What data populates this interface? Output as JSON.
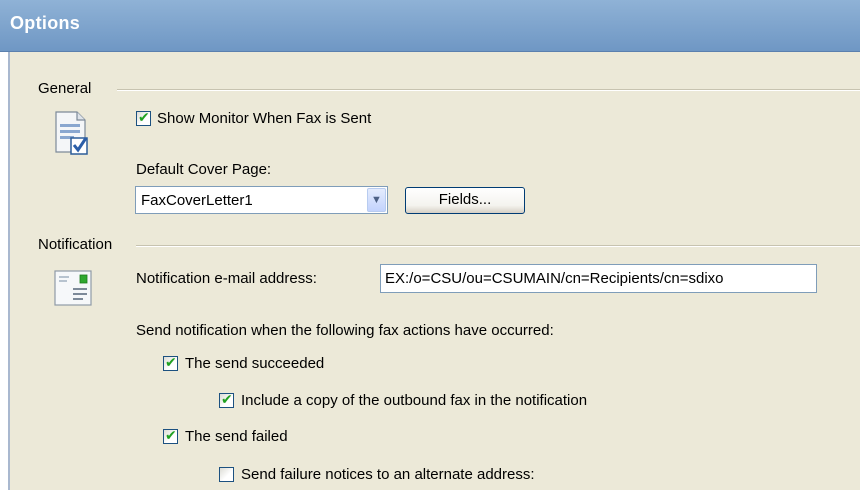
{
  "window": {
    "title": "Options"
  },
  "general": {
    "label": "General",
    "icon": "document-check-icon",
    "show_monitor": {
      "label": "Show Monitor When Fax is Sent",
      "checked": true
    },
    "cover_page": {
      "label": "Default Cover Page:",
      "selected": "FaxCoverLetter1",
      "fields_button": "Fields..."
    }
  },
  "notification": {
    "label": "Notification",
    "icon": "envelope-icon",
    "email_label": "Notification e-mail address:",
    "email_value": "EX:/o=CSU/ou=CSUMAIN/cn=Recipients/cn=sdixo",
    "actions_label": "Send notification when the following fax actions have occurred:",
    "send_succeeded": {
      "label": "The send succeeded",
      "checked": true
    },
    "include_copy": {
      "label": "Include a copy of the outbound fax in the notification",
      "checked": true
    },
    "send_failed": {
      "label": "The send failed",
      "checked": true
    },
    "alternate_address": {
      "label": "Send failure notices to an alternate address:",
      "checked": false
    }
  },
  "colors": {
    "title_bar": "#7aa1cc",
    "panel": "#ece9d8",
    "checkmark": "#21a121"
  }
}
